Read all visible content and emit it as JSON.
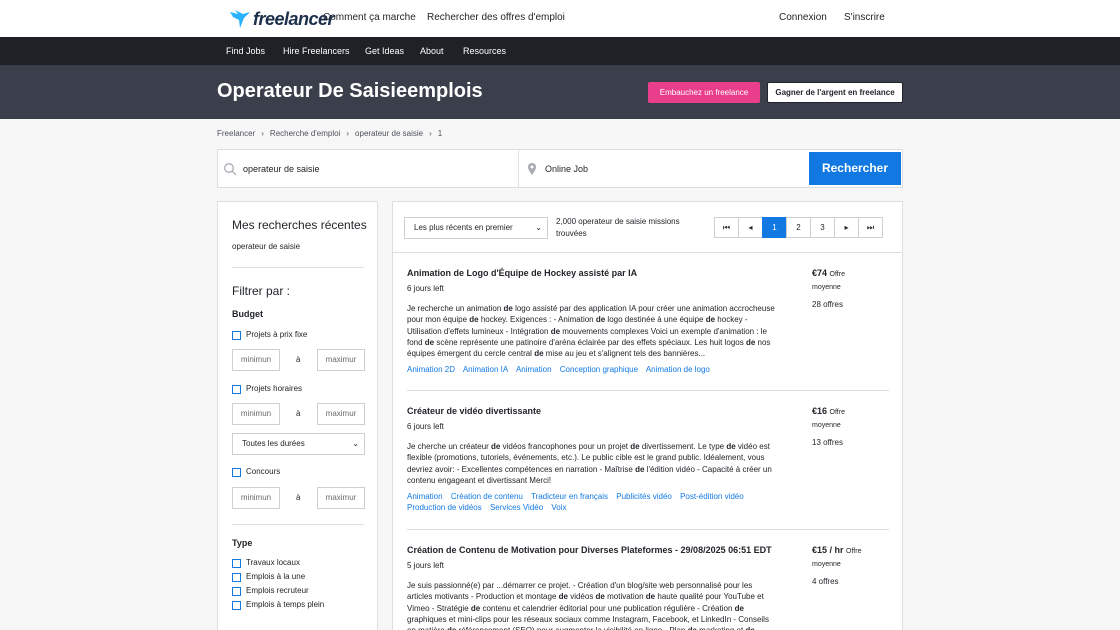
{
  "topbar": {
    "brand": "freelancer",
    "links": [
      "Comment ça marche",
      "Rechercher des offres d'emploi"
    ],
    "login": "Connexion",
    "signup": "S'inscrire"
  },
  "navbar": {
    "items": [
      "Find Jobs",
      "Hire Freelancers",
      "Get Ideas",
      "About",
      "Resources"
    ]
  },
  "hero": {
    "title": "Operateur De Saisieemplois",
    "hire_button": "Embauchez un freelance",
    "earn_button": "Gagner de l'argent en freelance"
  },
  "breadcrumb": [
    "Freelancer",
    "Recherche d'emploi",
    "operateur de saisie",
    "1"
  ],
  "search": {
    "query": "operateur de saisie",
    "location": "Online Job",
    "button": "Rechercher"
  },
  "sidebar": {
    "recent_title": "Mes recherches récentes",
    "recent_item": "operateur de saisie",
    "filter_title": "Filtrer par :",
    "budget_title": "Budget",
    "fixed_label": "Projets à prix fixe",
    "hourly_label": "Projets horaires",
    "contest_label": "Concours",
    "min_placeholder": "minimun",
    "max_placeholder": "maximur",
    "to_label": "à",
    "duration": "Toutes les durées",
    "type_title": "Type",
    "types": [
      "Travaux locaux",
      "Emplois à la une",
      "Emplois recruteur",
      "Emplois à temps plein"
    ]
  },
  "results": {
    "sort": "Les plus récents en premier",
    "count": "2,000 operateur de saisie missions trouvées",
    "pages": [
      "1",
      "2",
      "3"
    ],
    "active_page": "1"
  },
  "jobs": [
    {
      "title": "Animation de Logo d'Équipe de Hockey assisté par IA",
      "days": "6 jours left",
      "desc_parts": [
        [
          "Je recherche un animation ",
          ""
        ],
        [
          "de",
          "b"
        ],
        [
          " logo assisté par des application IA pour créer une animation accrocheuse pour mon équipe ",
          ""
        ],
        [
          "de",
          "b"
        ],
        [
          " hockey. Exigences : - Animation ",
          ""
        ],
        [
          "de",
          "b"
        ],
        [
          " logo destinée à une équipe ",
          ""
        ],
        [
          "de",
          "b"
        ],
        [
          " hockey - Utilisation d'effets lumineux - Intégration ",
          ""
        ],
        [
          "de",
          "b"
        ],
        [
          " mouvements complexes Voici un exemple d'animation : le fond ",
          ""
        ],
        [
          "de",
          "b"
        ],
        [
          " scène représente une patinoire d'aréna éclairée par des effets spéciaux. Les huit logos ",
          ""
        ],
        [
          "de",
          "b"
        ],
        [
          " nos équipes émergent du cercle central ",
          ""
        ],
        [
          "de",
          "b"
        ],
        [
          " mise au jeu et s'alignent tels des bannières...",
          ""
        ]
      ],
      "tags": [
        "Animation 2D",
        "Animation IA",
        "Animation",
        "Conception graphique",
        "Animation de logo"
      ],
      "price": "€74",
      "price_suffix": "Offre",
      "price_sub": "moyenne",
      "offers": "28 offres"
    },
    {
      "title": "Créateur de vidéo divertissante",
      "days": "6 jours left",
      "desc_parts": [
        [
          "Je cherche un créateur ",
          ""
        ],
        [
          "de",
          "b"
        ],
        [
          " vidéos francophones pour un projet ",
          ""
        ],
        [
          "de",
          "b"
        ],
        [
          " divertissement. Le type ",
          ""
        ],
        [
          "de",
          "b"
        ],
        [
          " vidéo est flexible (promotions, tutoriels, événements, etc.). Le public cible est le grand public. Idéalement, vous devriez avoir: - Excellentes compétences en narration - Maîtrise ",
          ""
        ],
        [
          "de",
          "b"
        ],
        [
          " l'édition vidéo - Capacité à créer un contenu engageant et divertissant Merci!",
          ""
        ]
      ],
      "tags": [
        "Animation",
        "Création de contenu",
        "Tradicteur en français",
        "Publicités vidéo",
        "Post-édition vidéo",
        "Production de vidéos",
        "Services Vidéo",
        "Voix"
      ],
      "price": "€16",
      "price_suffix": "Offre",
      "price_sub": "moyenne",
      "offers": "13 offres"
    },
    {
      "title": "Création de Contenu de Motivation pour Diverses Plateformes - 29/08/2025 06:51 EDT",
      "days": "5 jours left",
      "desc_parts": [
        [
          "Je suis passionné(e) par ...démarrer ce projet. - Création d'un blog/site web personnalisé pour les articles motivants - Production et montage ",
          ""
        ],
        [
          "de",
          "b"
        ],
        [
          " vidéos ",
          ""
        ],
        [
          "de",
          "b"
        ],
        [
          " motivation ",
          ""
        ],
        [
          "de",
          "b"
        ],
        [
          " haute qualité pour YouTube et Vimeo - Stratégie ",
          ""
        ],
        [
          "de",
          "b"
        ],
        [
          " contenu et calendrier éditorial pour une publication régulière - Création ",
          ""
        ],
        [
          "de",
          "b"
        ],
        [
          " graphiques et mini-clips pour les réseaux sociaux comme Instagram, Facebook, et LinkedIn - Conseils en matière ",
          ""
        ],
        [
          "de",
          "b"
        ],
        [
          " référencement (SEO) pour augmenter la visibilité en ligne - Plan ",
          ""
        ],
        [
          "de",
          "b"
        ],
        [
          " marketing et ",
          ""
        ],
        [
          "de",
          "b"
        ]
      ],
      "tags": [],
      "price": "€15 / hr",
      "price_suffix": "Offre",
      "price_sub": "moyenne",
      "offers": "4 offres"
    }
  ],
  "colors": {
    "accent": "#1279e2",
    "pink": "#e83e8c",
    "navbar": "#1f2127",
    "hero": "#3a3f4b"
  }
}
